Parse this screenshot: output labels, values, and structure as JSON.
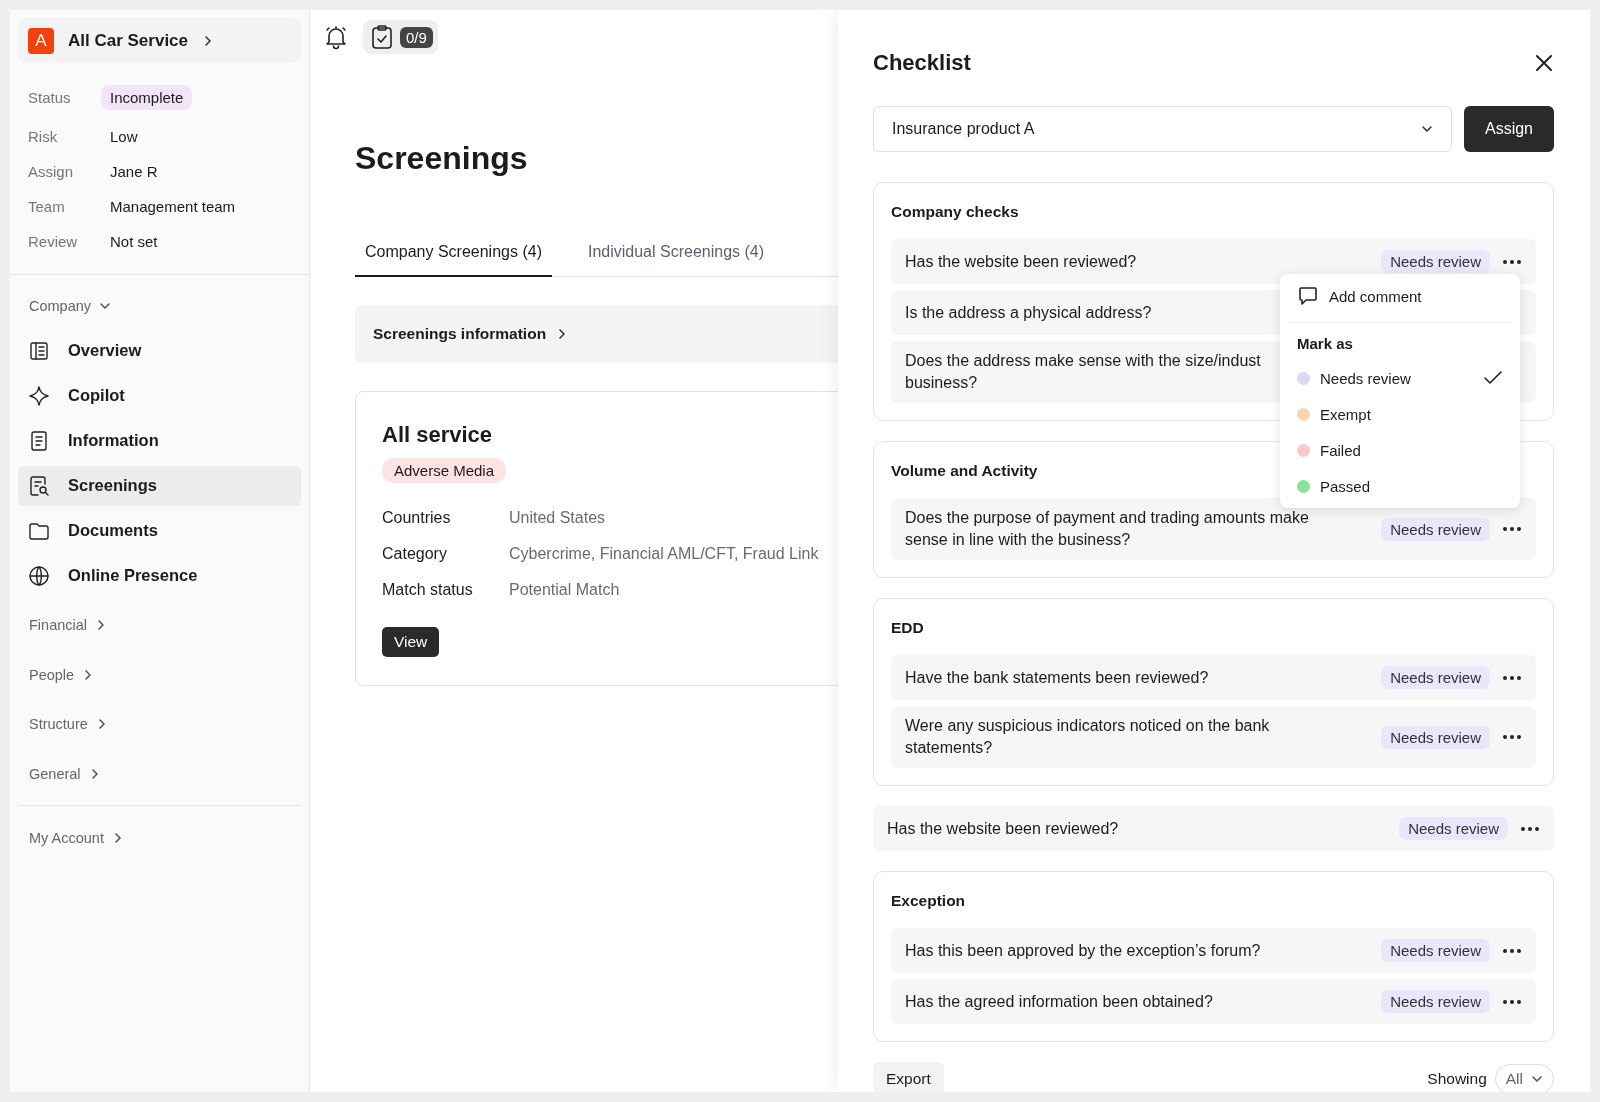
{
  "sidebar": {
    "company": {
      "logo_letter": "A",
      "name": "All Car Service"
    },
    "details": [
      {
        "label": "Status",
        "value": "Incomplete",
        "kind": "badge"
      },
      {
        "label": "Risk",
        "value": "Low",
        "kind": "text"
      },
      {
        "label": "Assign",
        "value": "Jane R",
        "kind": "text"
      },
      {
        "label": "Team",
        "value": "Management team",
        "kind": "text"
      },
      {
        "label": "Review",
        "value": "Not set",
        "kind": "text"
      }
    ],
    "nav": [
      {
        "label": "Company",
        "expanded": true,
        "children": [
          {
            "label": "Overview",
            "selected": false
          },
          {
            "label": "Copilot",
            "selected": false
          },
          {
            "label": "Information",
            "selected": false
          },
          {
            "label": "Screenings",
            "selected": true
          },
          {
            "label": "Documents",
            "selected": false
          },
          {
            "label": "Online Presence",
            "selected": false
          }
        ]
      },
      {
        "label": "Financial",
        "expanded": false
      },
      {
        "label": "People",
        "expanded": false
      },
      {
        "label": "Structure",
        "expanded": false
      },
      {
        "label": "General",
        "expanded": false
      }
    ],
    "account": {
      "label": "My Account",
      "expanded": false
    }
  },
  "topbar": {
    "checklist_count": "0/9"
  },
  "main": {
    "title": "Screenings",
    "tabs": [
      {
        "label": "Company Screenings (4)",
        "selected": true
      },
      {
        "label": "Individual Screenings (4)",
        "selected": false
      }
    ],
    "info_bar": "Screenings information",
    "card": {
      "title": "All service",
      "tag": "Adverse Media",
      "fields": [
        {
          "label": "Countries",
          "value": "United States"
        },
        {
          "label": "Category",
          "value": "Cybercrime, Financial AML/CFT, Fraud Link"
        },
        {
          "label": "Match status",
          "value": "Potential Match"
        }
      ],
      "button": "View"
    }
  },
  "checklist": {
    "title": "Checklist",
    "product": "Insurance product A",
    "assign": "Assign",
    "blocks": [
      {
        "kind": "section",
        "title": "Company checks",
        "rows": [
          {
            "lines": [
              "Has the website been reviewed?"
            ],
            "status": "Needs review",
            "menu_open": true
          },
          {
            "lines": [
              "Is the address a physical address?"
            ]
          },
          {
            "lines": [
              "Does the address make sense with the size/indust",
              "business?"
            ]
          }
        ]
      },
      {
        "kind": "section",
        "title": "Volume and Activity",
        "rows": [
          {
            "lines": [
              "Does the purpose of payment and trading amounts make",
              "sense in line with the business?"
            ],
            "status": "Needs review"
          }
        ]
      },
      {
        "kind": "section",
        "title": "EDD",
        "rows": [
          {
            "lines": [
              "Have the bank statements been reviewed?"
            ],
            "status": "Needs review"
          },
          {
            "lines": [
              "Were any suspicious indicators noticed on the bank",
              "statements?"
            ],
            "status": "Needs review"
          }
        ]
      },
      {
        "kind": "row",
        "lines": [
          "Has the website been reviewed?"
        ],
        "status": "Needs review"
      },
      {
        "kind": "section",
        "title": "Exception",
        "rows": [
          {
            "lines": [
              "Has this been approved by the exception’s forum?"
            ],
            "status": "Needs review"
          },
          {
            "lines": [
              "Has the agreed information been obtained?"
            ],
            "status": "Needs review"
          }
        ]
      }
    ],
    "menu": {
      "add_comment": "Add comment",
      "heading": "Mark as",
      "options": [
        {
          "label": "Needs review",
          "color": "#ddd6f7",
          "selected": true
        },
        {
          "label": "Exempt",
          "color": "#fdd3b0",
          "selected": false
        },
        {
          "label": "Failed",
          "color": "#fcc9c9",
          "selected": false
        },
        {
          "label": "Passed",
          "color": "#86e49a",
          "selected": false
        }
      ]
    },
    "footer": {
      "export": "Export",
      "showing_label": "Showing",
      "filter": "All"
    }
  }
}
